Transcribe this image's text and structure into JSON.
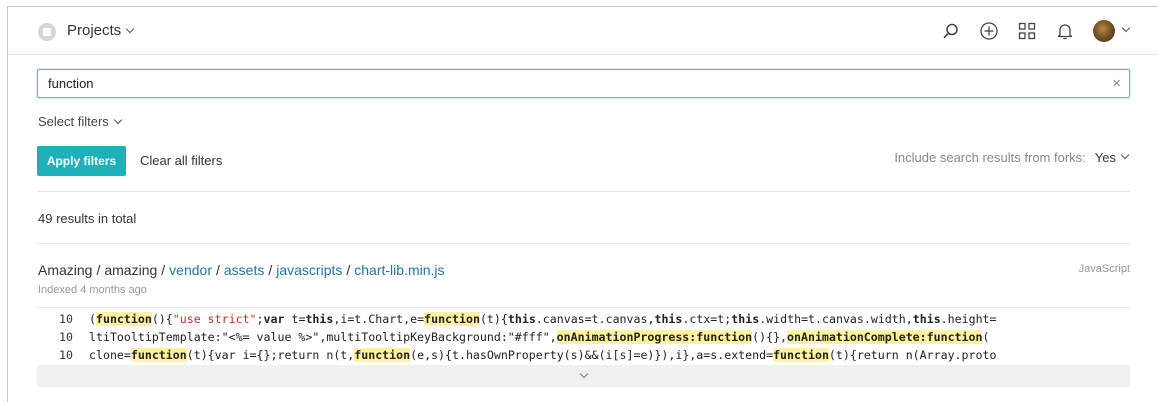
{
  "header": {
    "project_title": "Projects"
  },
  "search": {
    "value": "function",
    "clear_symbol": "×"
  },
  "filters": {
    "select_label": "Select filters",
    "apply_label": "Apply filters",
    "clear_label": "Clear all filters",
    "forks_label": "Include search results from forks:",
    "forks_value": "Yes"
  },
  "results": {
    "count_text": "49 results in total",
    "item": {
      "path": [
        "Amazing",
        "amazing",
        "vendor",
        "assets",
        "javascripts",
        "chart-lib.min.js"
      ],
      "language": "JavaScript",
      "indexed": "Indexed 4 months ago",
      "line_numbers": [
        "10",
        "10",
        "10"
      ]
    }
  },
  "icons": [
    "search-icon",
    "add-circle-icon",
    "apps-grid-icon",
    "bell-icon",
    "avatar",
    "chevron-down-icon"
  ],
  "colors": {
    "accent": "#1fb0ba",
    "link": "#2574a9",
    "highlight": "#fff2a1",
    "search_border": "#5cbcc4"
  }
}
